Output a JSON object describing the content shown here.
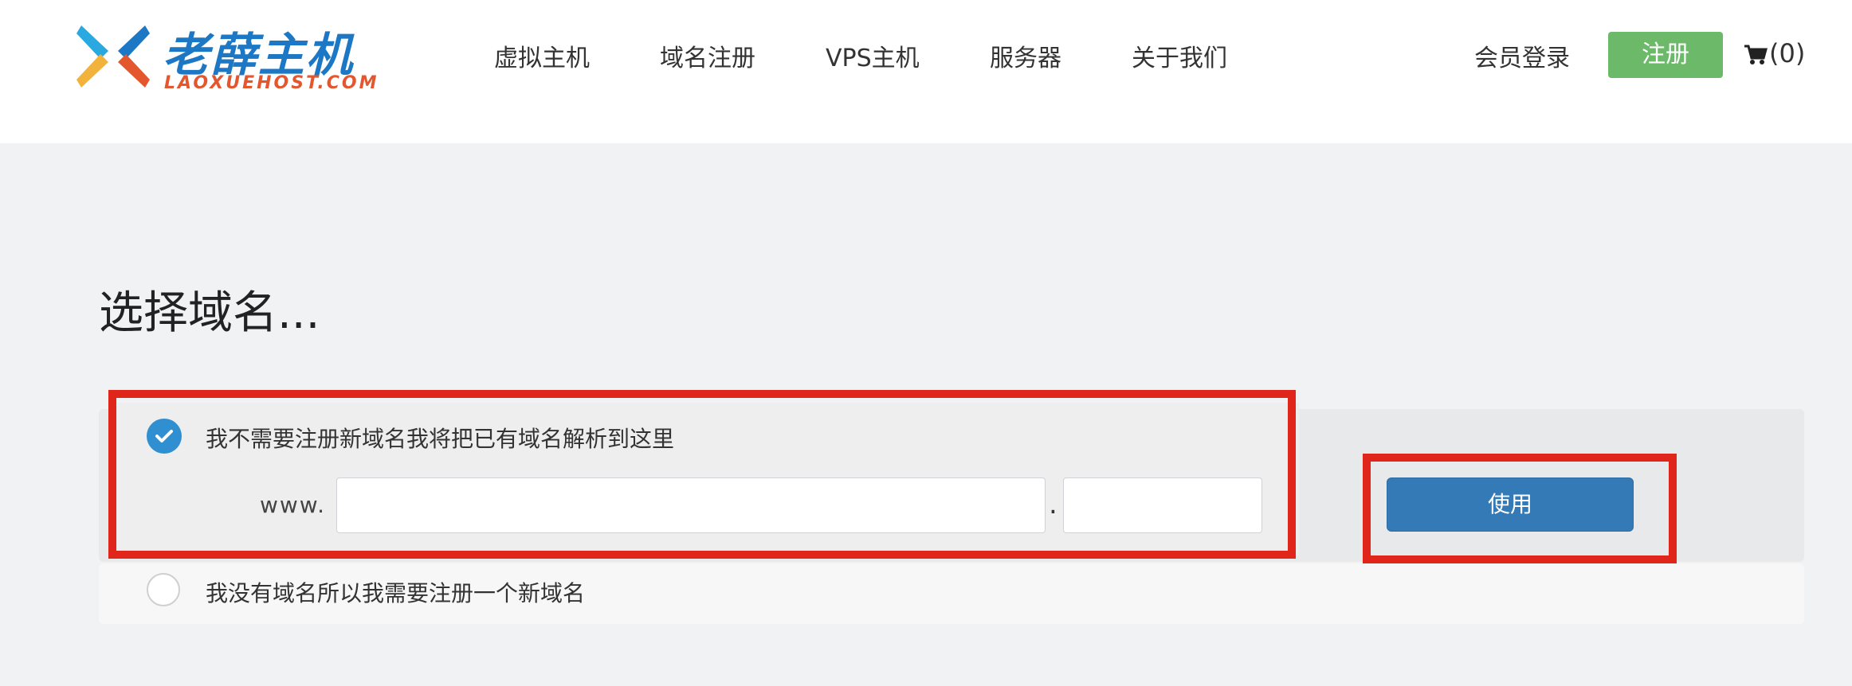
{
  "brand": {
    "logo_text": "老薛主机",
    "logo_subtext": "LAOXUEHOST.COM"
  },
  "nav": {
    "items": [
      {
        "label": "虚拟主机"
      },
      {
        "label": "域名注册"
      },
      {
        "label": "VPS主机"
      },
      {
        "label": "服务器"
      },
      {
        "label": "关于我们"
      }
    ],
    "login_label": "会员登录",
    "register_label": "注册",
    "cart_count": "(0)"
  },
  "main": {
    "title": "选择域名...",
    "option_existing": {
      "label": "我不需要注册新域名我将把已有域名解析到这里",
      "selected": true,
      "prefix": "www.",
      "domain_value": "",
      "separator": ".",
      "tld_value": "",
      "use_button": "使用"
    },
    "option_new": {
      "label": "我没有域名所以我需要注册一个新域名",
      "selected": false
    }
  },
  "colors": {
    "accent_blue": "#337ab7",
    "register_green": "#6cb96a",
    "highlight_red": "#e0261b",
    "radio_checked": "#2f8fd0"
  },
  "icons": [
    "logo-mark-icon",
    "cart-icon",
    "check-icon"
  ]
}
